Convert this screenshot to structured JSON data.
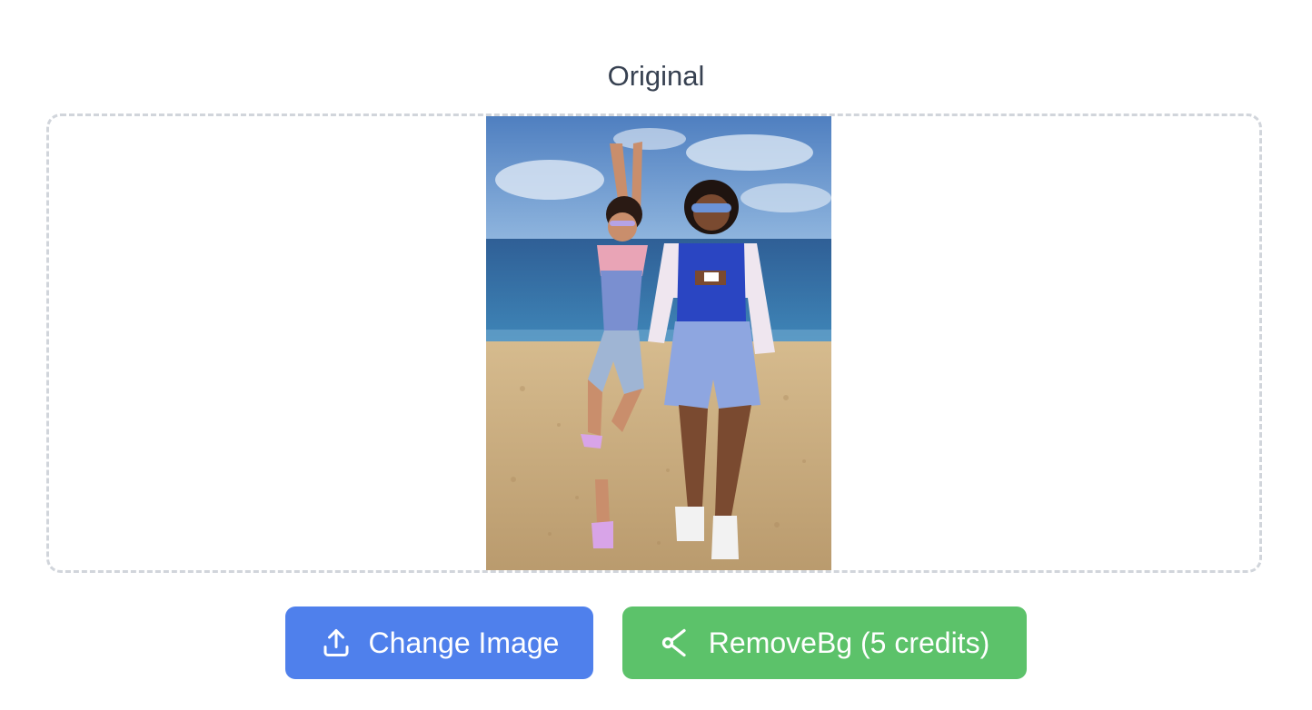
{
  "panel": {
    "title": "Original"
  },
  "image": {
    "alt": "Two women posing on a beach"
  },
  "actions": {
    "change_label": "Change Image",
    "change_icon": "upload-icon",
    "remove_label": "RemoveBg (5 credits)",
    "remove_icon": "scissors-icon"
  },
  "colors": {
    "change_button": "#4f80ec",
    "remove_button": "#5cc26a",
    "dropzone_border": "#d1d5db",
    "title_text": "#374151"
  }
}
